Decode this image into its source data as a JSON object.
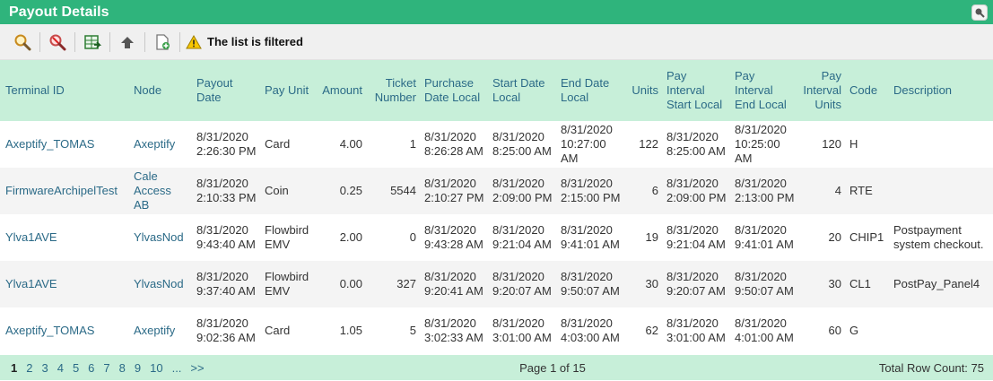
{
  "title": "Payout Details",
  "toolbar": {
    "icons": [
      "search-icon",
      "clear-filter-icon",
      "export-excel-icon",
      "upload-icon",
      "new-report-icon"
    ],
    "filter_message": "The list is filtered"
  },
  "columns": [
    {
      "key": "terminal_id",
      "label": "Terminal ID"
    },
    {
      "key": "node",
      "label": "Node"
    },
    {
      "key": "payout_date",
      "label": "Payout Date"
    },
    {
      "key": "pay_unit",
      "label": "Pay Unit"
    },
    {
      "key": "amount",
      "label": "Amount"
    },
    {
      "key": "ticket_number",
      "label": "Ticket Number"
    },
    {
      "key": "purchase_date_local",
      "label": "Purchase Date Local"
    },
    {
      "key": "start_date_local",
      "label": "Start Date Local"
    },
    {
      "key": "end_date_local",
      "label": "End Date Local"
    },
    {
      "key": "units",
      "label": "Units"
    },
    {
      "key": "pay_interval_start_local",
      "label": "Pay Interval Start Local"
    },
    {
      "key": "pay_interval_end_local",
      "label": "Pay Interval End Local"
    },
    {
      "key": "pay_interval_units",
      "label": "Pay Interval Units"
    },
    {
      "key": "code",
      "label": "Code"
    },
    {
      "key": "description",
      "label": "Description"
    }
  ],
  "rows": [
    {
      "terminal_id": "Axeptify_TOMAS",
      "node": "Axeptify",
      "payout_date": "8/31/2020 2:26:30 PM",
      "pay_unit": "Card",
      "amount": "4.00",
      "ticket_number": "1",
      "purchase_date_local": "8/31/2020 8:26:28 AM",
      "start_date_local": "8/31/2020 8:25:00 AM",
      "end_date_local": "8/31/2020 10:27:00 AM",
      "units": "122",
      "pay_interval_start_local": "8/31/2020 8:25:00 AM",
      "pay_interval_end_local": "8/31/2020 10:25:00 AM",
      "pay_interval_units": "120",
      "code": "H",
      "description": ""
    },
    {
      "terminal_id": "FirmwareArchipelTest",
      "node": "Cale Access AB",
      "payout_date": "8/31/2020 2:10:33 PM",
      "pay_unit": "Coin",
      "amount": "0.25",
      "ticket_number": "5544",
      "purchase_date_local": "8/31/2020 2:10:27 PM",
      "start_date_local": "8/31/2020 2:09:00 PM",
      "end_date_local": "8/31/2020 2:15:00 PM",
      "units": "6",
      "pay_interval_start_local": "8/31/2020 2:09:00 PM",
      "pay_interval_end_local": "8/31/2020 2:13:00 PM",
      "pay_interval_units": "4",
      "code": "RTE",
      "description": ""
    },
    {
      "terminal_id": "Ylva1AVE",
      "node": "YlvasNod",
      "payout_date": "8/31/2020 9:43:40 AM",
      "pay_unit": "Flowbird EMV",
      "amount": "2.00",
      "ticket_number": "0",
      "purchase_date_local": "8/31/2020 9:43:28 AM",
      "start_date_local": "8/31/2020 9:21:04 AM",
      "end_date_local": "8/31/2020 9:41:01 AM",
      "units": "19",
      "pay_interval_start_local": "8/31/2020 9:21:04 AM",
      "pay_interval_end_local": "8/31/2020 9:41:01 AM",
      "pay_interval_units": "20",
      "code": "CHIP1",
      "description": "Postpayment system checkout."
    },
    {
      "terminal_id": "Ylva1AVE",
      "node": "YlvasNod",
      "payout_date": "8/31/2020 9:37:40 AM",
      "pay_unit": "Flowbird EMV",
      "amount": "0.00",
      "ticket_number": "327",
      "purchase_date_local": "8/31/2020 9:20:41 AM",
      "start_date_local": "8/31/2020 9:20:07 AM",
      "end_date_local": "8/31/2020 9:50:07 AM",
      "units": "30",
      "pay_interval_start_local": "8/31/2020 9:20:07 AM",
      "pay_interval_end_local": "8/31/2020 9:50:07 AM",
      "pay_interval_units": "30",
      "code": "CL1",
      "description": "PostPay_Panel4"
    },
    {
      "terminal_id": "Axeptify_TOMAS",
      "node": "Axeptify",
      "payout_date": "8/31/2020 9:02:36 AM",
      "pay_unit": "Card",
      "amount": "1.05",
      "ticket_number": "5",
      "purchase_date_local": "8/31/2020 3:02:33 AM",
      "start_date_local": "8/31/2020 3:01:00 AM",
      "end_date_local": "8/31/2020 4:03:00 AM",
      "units": "62",
      "pay_interval_start_local": "8/31/2020 3:01:00 AM",
      "pay_interval_end_local": "8/31/2020 4:01:00 AM",
      "pay_interval_units": "60",
      "code": "G",
      "description": ""
    }
  ],
  "pagination": {
    "pages": [
      "1",
      "2",
      "3",
      "4",
      "5",
      "6",
      "7",
      "8",
      "9",
      "10",
      "...",
      ">>"
    ],
    "current": "1",
    "page_info": "Page 1 of 15",
    "total_row_count": "Total Row Count: 75"
  },
  "colors": {
    "title_bar": "#2fb47c",
    "header_bg": "#c7efd9",
    "link": "#2b6a87"
  }
}
